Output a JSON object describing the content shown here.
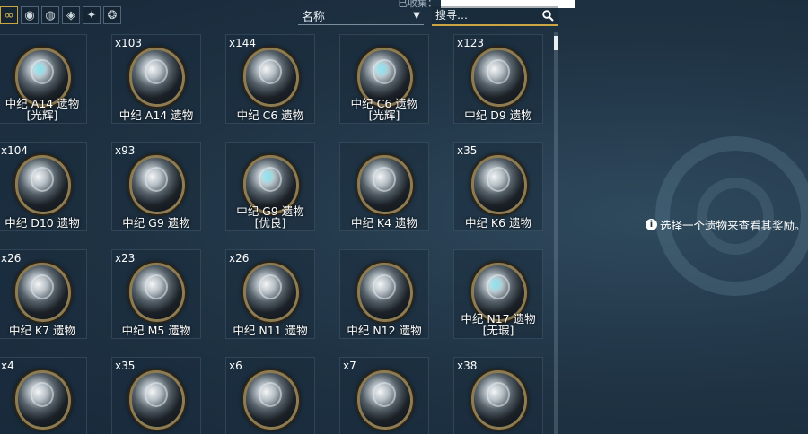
{
  "header": {
    "top_label": "已收集：",
    "sort": {
      "selected": "名称"
    },
    "search": {
      "placeholder": "搜寻…"
    },
    "filters": [
      "all-icon",
      "lith-icon",
      "meso-icon",
      "neo-icon",
      "axi-icon",
      "requiem-icon"
    ]
  },
  "relics": [
    {
      "count": "",
      "name": "中纪 A14 遗物",
      "refinement": "[光辉]",
      "glow": true
    },
    {
      "count": "x103",
      "name": "中纪 A14 遗物",
      "refinement": "",
      "glow": false
    },
    {
      "count": "x144",
      "name": "中纪 C6 遗物",
      "refinement": "",
      "glow": false
    },
    {
      "count": "",
      "name": "中纪 C6 遗物",
      "refinement": "[光辉]",
      "glow": true
    },
    {
      "count": "x123",
      "name": "中纪 D9 遗物",
      "refinement": "",
      "glow": false
    },
    {
      "count": "x104",
      "name": "中纪 D10 遗物",
      "refinement": "",
      "glow": false
    },
    {
      "count": "x93",
      "name": "中纪 G9 遗物",
      "refinement": "",
      "glow": false
    },
    {
      "count": "",
      "name": "中纪 G9 遗物",
      "refinement": "[优良]",
      "glow": true
    },
    {
      "count": "",
      "name": "中纪 K4 遗物",
      "refinement": "",
      "glow": false
    },
    {
      "count": "x35",
      "name": "中纪 K6 遗物",
      "refinement": "",
      "glow": false
    },
    {
      "count": "x26",
      "name": "中纪 K7 遗物",
      "refinement": "",
      "glow": false
    },
    {
      "count": "x23",
      "name": "中纪 M5 遗物",
      "refinement": "",
      "glow": false
    },
    {
      "count": "x26",
      "name": "中纪 N11 遗物",
      "refinement": "",
      "glow": false
    },
    {
      "count": "",
      "name": "中纪 N12 遗物",
      "refinement": "",
      "glow": false
    },
    {
      "count": "",
      "name": "中纪 N17 遗物",
      "refinement": "[无瑕]",
      "glow": true
    },
    {
      "count": "x4",
      "name": "",
      "refinement": "",
      "glow": false
    },
    {
      "count": "x35",
      "name": "",
      "refinement": "",
      "glow": false
    },
    {
      "count": "x6",
      "name": "",
      "refinement": "",
      "glow": false
    },
    {
      "count": "x7",
      "name": "",
      "refinement": "",
      "glow": false
    },
    {
      "count": "x38",
      "name": "",
      "refinement": "",
      "glow": false
    }
  ],
  "detail": {
    "hint": "选择一个遗物来查看其奖励。",
    "hint_icon": "info-icon",
    "emblem_icon": "relic-emblem-icon"
  }
}
